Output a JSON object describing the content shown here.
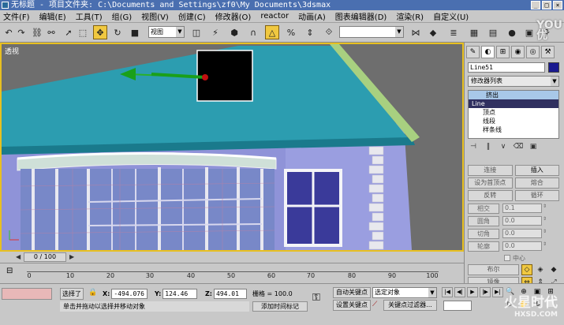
{
  "window": {
    "title": "无标题 - 项目文件夹: C:\\Documents and Settings\\zf0\\My Documents\\3dsmax",
    "min": "_",
    "max": "□",
    "close": "×"
  },
  "menu": [
    "文件(F)",
    "编辑(E)",
    "工具(T)",
    "组(G)",
    "视图(V)",
    "创建(C)",
    "修改器(O)",
    "reactor",
    "动画(A)",
    "图表编辑器(D)",
    "渲染(R)",
    "自定义(U)"
  ],
  "toolbar": {
    "view_coord": "视图",
    "select_set": ""
  },
  "viewport": {
    "label": "透视"
  },
  "command_panel": {
    "object_name": "Line51",
    "modifier_list": "修改器列表",
    "stack": {
      "extrude": "挤出",
      "line": "Line",
      "sub1": "顶点",
      "sub2": "线段",
      "sub3": "样条线"
    },
    "buttons": {
      "connect": "连接",
      "insert": "插入",
      "set_first": "设为首顶点",
      "fuse": "熔合",
      "reverse": "反转",
      "cycle": "循环",
      "intersect": "相交",
      "fillet": "圆角",
      "chamfer": "切角",
      "outline": "轮廓",
      "center": "中心",
      "boolean": "布尔",
      "mirror": "镜像"
    },
    "values": {
      "intersect": "0.1",
      "fillet": "0.0",
      "chamfer": "0.0",
      "outline": "0.0"
    }
  },
  "timeline": {
    "frame": "0 / 100",
    "ticks": [
      "0",
      "10",
      "20",
      "30",
      "40",
      "50",
      "60",
      "70",
      "80",
      "90",
      "100"
    ]
  },
  "status": {
    "selected": "选择了",
    "x_label": "X:",
    "x": "-494.076",
    "y_label": "Y:",
    "y": "124.46",
    "z_label": "Z:",
    "z": "494.01",
    "grid": "栅格 = 100.0",
    "auto_key": "自动关键点",
    "set_key": "设置关键点",
    "selection": "选定对象",
    "key_filter": "关键点过滤器...",
    "prompt": "单击并拖动以选择并移动对象",
    "add_time": "添加时间标记"
  },
  "watermark": {
    "main": "火星时代",
    "sub": "HXSD.COM",
    "corner1": "YOU",
    "corner2": "优"
  },
  "colors": {
    "roof": "#2c9db0",
    "wall": "#9a9ee0",
    "trim": "#a8d080",
    "viewport_bg": "#6e6e6e",
    "active_tool": "#f0c840"
  }
}
